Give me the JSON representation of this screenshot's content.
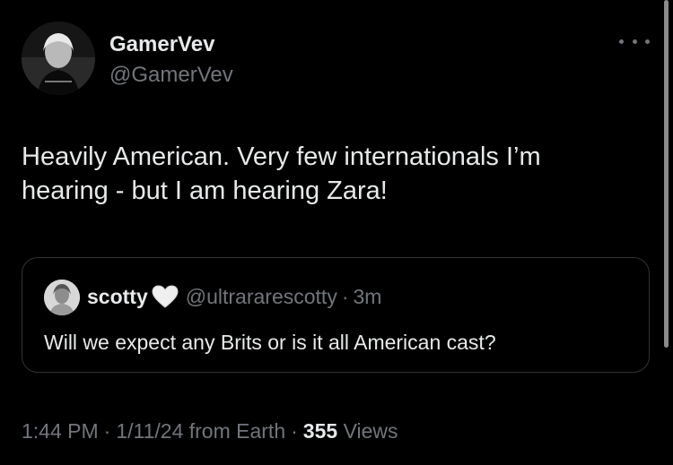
{
  "author": {
    "display_name": "GamerVev",
    "handle": "@GamerVev",
    "avatar_icon": "profile-photo"
  },
  "tweet": {
    "line1": "Heavily American. Very few internationals I’m",
    "line2": "hearing - but I am hearing Zara!"
  },
  "quoted": {
    "display_name": "scotty",
    "heart_icon": "white-heart-emoji",
    "handle": "@ultrararescotty",
    "separator": "·",
    "time": "3m",
    "text": "Will we expect any Brits or is it all American cast?"
  },
  "meta": {
    "time": "1:44 PM",
    "sep1": "·",
    "date": "1/11/24",
    "source": "from Earth",
    "sep2": "·",
    "views_count": "355",
    "views_label": "Views"
  },
  "colors": {
    "background": "#000000",
    "text": "#e7e9ea",
    "secondary": "#71767b",
    "border": "#2f3336"
  }
}
